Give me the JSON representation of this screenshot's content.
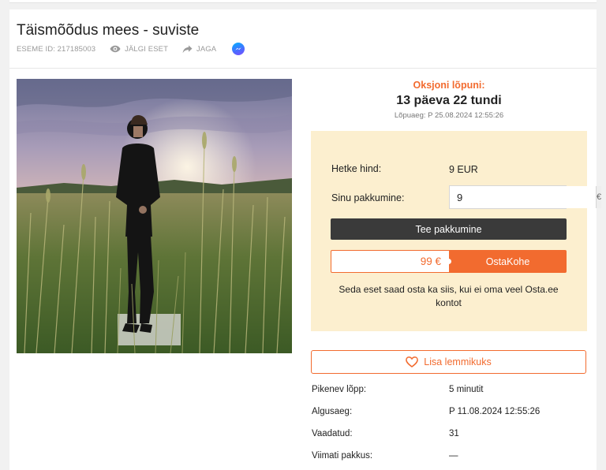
{
  "listing": {
    "title": "Täismõõdus mees - suviste",
    "item_id_label": "ESEME ID: 217185003",
    "watch_label": "JÄLGI ESET",
    "share_label": "JAGA"
  },
  "auction": {
    "end_label": "Oksjoni lõpuni:",
    "remaining": "13 päeva 22 tundi",
    "end_date": "Lõpuaeg: P 25.08.2024 12:55:26"
  },
  "bid": {
    "current_price_label": "Hetke hind:",
    "current_price": "9 EUR",
    "your_bid_label": "Sinu pakkumine:",
    "your_bid_value": "9",
    "currency_symbol": "€",
    "bid_button": "Tee pakkumine",
    "buy_now_price": "99 €",
    "buy_now_button": "OstaKohe",
    "buy_note": "Seda eset saad osta ka siis, kui ei oma veel Osta.ee kontot"
  },
  "favorite_label": "Lisa lemmikuks",
  "info": [
    {
      "label": "Pikenev lõpp:",
      "value": "5 minutit"
    },
    {
      "label": "Algusaeg:",
      "value": "P 11.08.2024 12:55:26"
    },
    {
      "label": "Vaadatud:",
      "value": "31"
    },
    {
      "label": "Viimati pakkus:",
      "value": "—"
    }
  ],
  "colors": {
    "accent": "#f26b2f",
    "bid_box_bg": "#fcefcf",
    "dark_button": "#3a3a3a"
  },
  "icons": [
    "eye-icon",
    "share-arrow-icon",
    "messenger-icon",
    "heart-icon"
  ]
}
